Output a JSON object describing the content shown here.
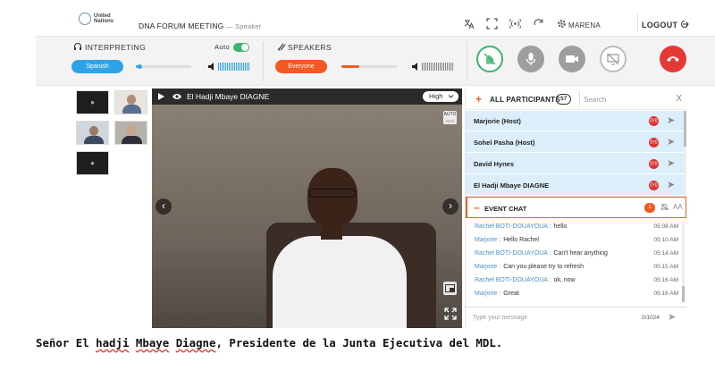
{
  "header": {
    "org_logo_line1": "United",
    "org_logo_line2": "Nations",
    "meeting_title": "DNA FORUM MEETING",
    "role": "— Speaker",
    "username": "MARENA",
    "logout_label": "LOGOUT",
    "icons": [
      "language-icon",
      "fullscreen-icon",
      "signal-icon",
      "refresh-icon",
      "settings-icon"
    ]
  },
  "controls": {
    "interpreting_label": "INTERPRETING",
    "auto_label": "Auto",
    "auto_enabled": true,
    "language_value": "Spanish",
    "speakers_label": "SPEAKERS",
    "speakers_value": "Everyone",
    "accent_blue": "#2ea3e8",
    "accent_orange": "#f15a22",
    "end_call_color": "#e53935"
  },
  "video": {
    "speaker_name": "El Hadji Mbaye DIAGNE",
    "quality": "High",
    "auto_badge": "AUTO"
  },
  "participants": {
    "header_label": "ALL PARTICIPANTS",
    "count": "57",
    "search_placeholder": "Search",
    "close_label": "X",
    "items": [
      {
        "name": "Marjorie (Host)"
      },
      {
        "name": "Sohel Pasha (Host)"
      },
      {
        "name": "David Hynes"
      },
      {
        "name": "El Hadji Mbaye DIAGNE"
      }
    ]
  },
  "chat": {
    "header_label": "EVENT CHAT",
    "unread": "1",
    "font_size_label": "AA",
    "messages": [
      {
        "sender": "Rachel BOTI-DOUAYOUA :",
        "text": "hello",
        "time": "05:08 AM"
      },
      {
        "sender": "Marjorie :",
        "text": "Hello Rachel",
        "time": "05:10 AM"
      },
      {
        "sender": "Rachel BOTI-DOUAYOUA :",
        "text": "Can't hear anything",
        "time": "05:14 AM"
      },
      {
        "sender": "Marjorie :",
        "text": "Can you please try to refresh",
        "time": "05:15 AM"
      },
      {
        "sender": "Rachel BOTI-DOUAYOUA :",
        "text": "ok, now",
        "time": "05:16 AM"
      },
      {
        "sender": "Marjorie :",
        "text": "Great",
        "time": "05:16 AM"
      }
    ],
    "input_placeholder": "Type your message",
    "char_count": "0/1024"
  },
  "caption": {
    "before": "Señor El ",
    "underlined1": "hadji",
    "middle1": " ",
    "underlined2": "Mbaye",
    "middle2": " ",
    "underlined3": "Diagne",
    "after": ", Presidente de la Junta Ejecutiva del MDL."
  }
}
